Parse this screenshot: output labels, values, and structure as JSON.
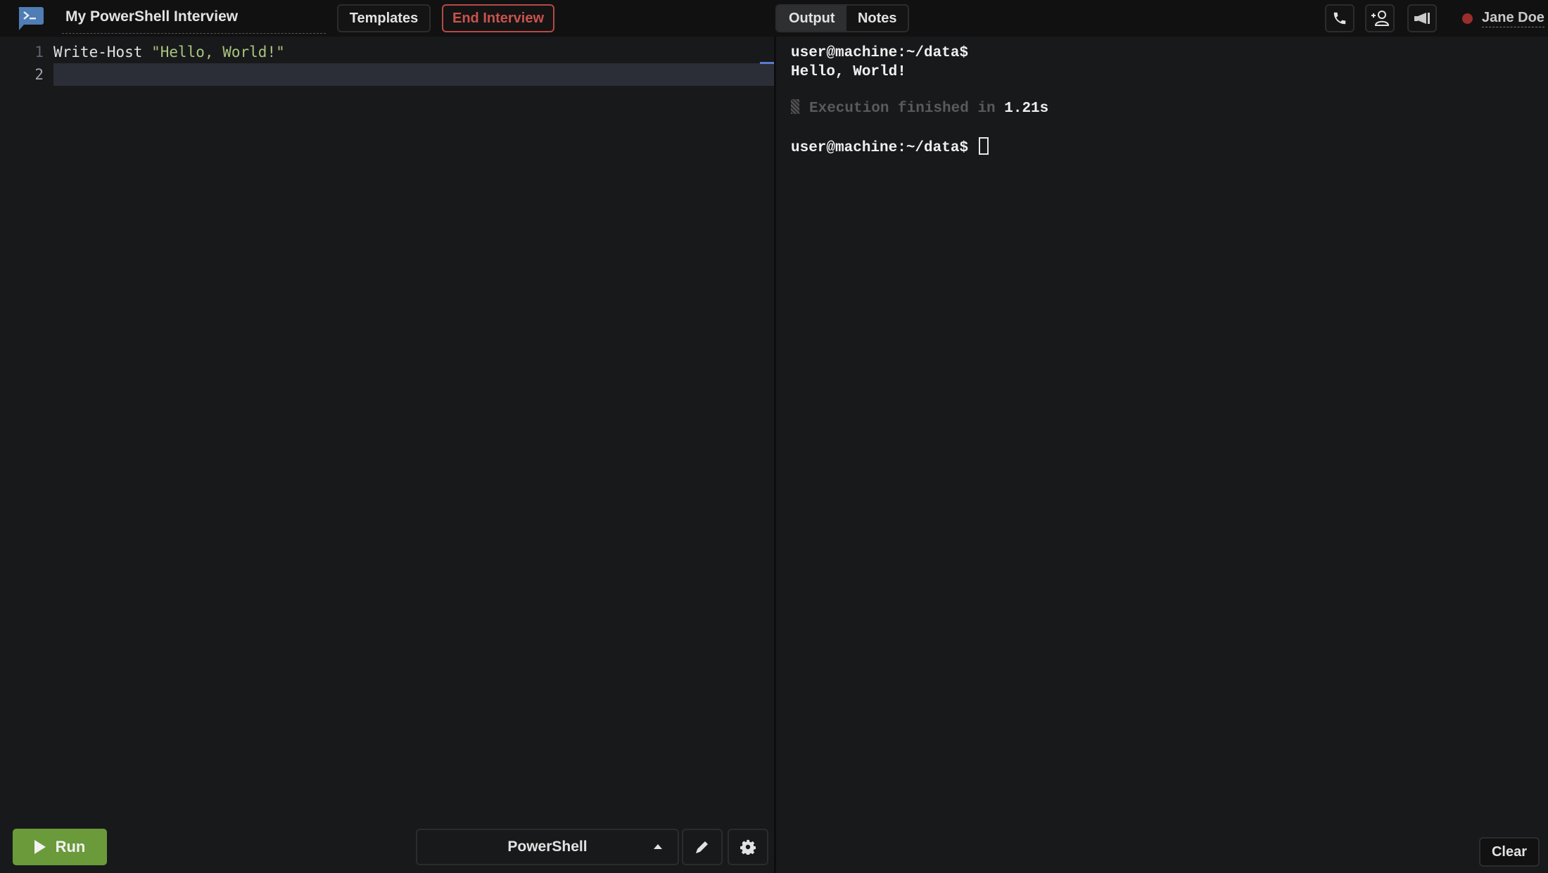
{
  "header": {
    "app_icon": "terminal-chat-icon",
    "title": "My PowerShell Interview",
    "templates_label": "Templates",
    "end_interview_label": "End Interview",
    "tabs": [
      {
        "label": "Output",
        "active": true
      },
      {
        "label": "Notes",
        "active": false
      }
    ],
    "icons": [
      "phone-icon",
      "add-user-icon",
      "megaphone-icon"
    ],
    "status_color": "#9b2d2a",
    "user_name": "Jane Doe"
  },
  "editor": {
    "lines": [
      {
        "number": "1",
        "keyword": "Write-Host ",
        "string": "\"Hello, World!\""
      },
      {
        "number": "2",
        "keyword": "",
        "string": ""
      }
    ],
    "active_line": 2
  },
  "footer": {
    "run_label": "Run",
    "language": "PowerShell",
    "run_color": "#6a9a3a"
  },
  "output": {
    "prompt": "user@machine:~/data$",
    "stdout": "Hello, World!",
    "exec_prefix": "Execution finished in ",
    "exec_time": "1.21s",
    "prompt2": "user@machine:~/data$ ",
    "clear_label": "Clear"
  }
}
